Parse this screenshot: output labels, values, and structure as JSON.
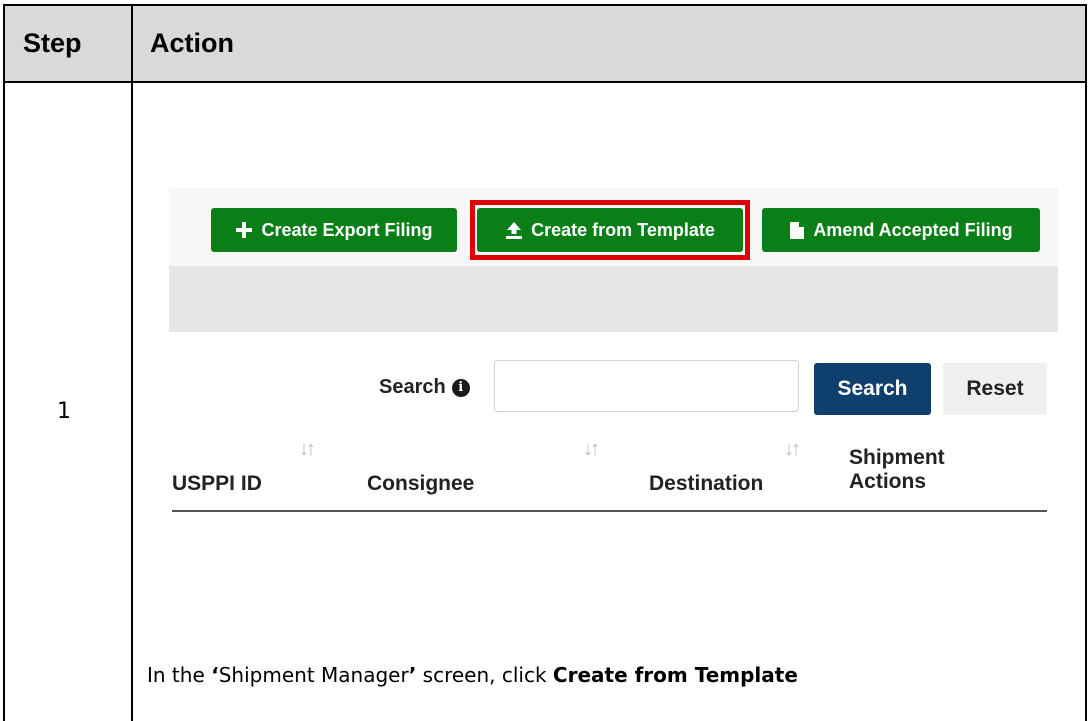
{
  "table": {
    "header_step": "Step",
    "header_action": "Action",
    "step_number": "1"
  },
  "screenshot": {
    "buttons": {
      "create_export": "Create Export Filing",
      "create_template": "Create from Template",
      "amend": "Amend Accepted Filing"
    },
    "search": {
      "label": "Search",
      "input_value": "",
      "search_button": "Search",
      "reset_button": "Reset"
    },
    "columns": {
      "usppi": "USPPI ID",
      "consignee": "Consignee",
      "destination": "Destination",
      "shipment_line1": "Shipment",
      "shipment_line2": "Actions"
    },
    "colors": {
      "green": "#0a7f18",
      "navy": "#0e3f6d",
      "highlight": "#e00000"
    }
  },
  "instruction": {
    "prefix": "In the ",
    "quote_open": "‘",
    "screen_name": "Shipment Manager",
    "quote_close": "’",
    "middle": " screen, click ",
    "target": "Create from Template"
  }
}
